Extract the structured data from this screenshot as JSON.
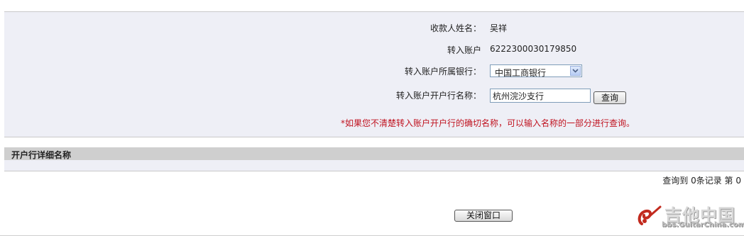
{
  "form": {
    "payee_name_label": "收款人姓名：",
    "payee_name_value": "吴祥",
    "account_label": "转入账户",
    "account_value": "6222300030179850",
    "bank_label": "转入账户所属银行：",
    "bank_selected": "中国工商银行",
    "branch_label": "转入账户开户行名称：",
    "branch_value": "杭州浣沙支行",
    "query_button": "查询",
    "note": "*如果您不清楚转入账户开户行的确切名称，可以输入名称的一部分进行查询。"
  },
  "results": {
    "section_title": "开户行详细名称",
    "summary": "查询到 0条记录  第 0"
  },
  "footer": {
    "close_button": "关闭窗口"
  },
  "watermark": {
    "title": "吉他中国",
    "url": "bbs.GuitarChina.com"
  },
  "colors": {
    "panel_bg": "#eeeff6",
    "section_bg": "#cfcfcf",
    "note": "#c0121f"
  }
}
